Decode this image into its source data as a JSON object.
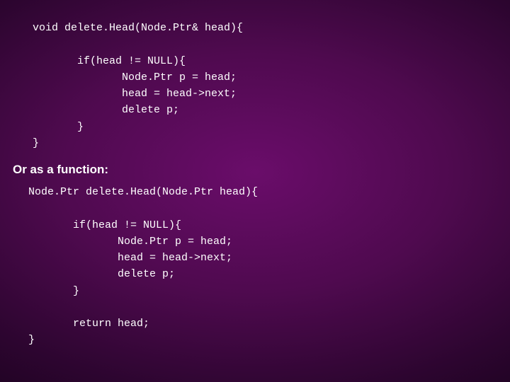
{
  "code1": {
    "l1": "void delete.Head(Node.Ptr& head){",
    "l2": "",
    "l3": "       if(head != NULL){",
    "l4": "              Node.Ptr p = head;",
    "l5": "              head = head->next;",
    "l6": "              delete p;",
    "l7": "       }",
    "l8": "}"
  },
  "caption": "Or as a function:",
  "code2": {
    "l1": "Node.Ptr delete.Head(Node.Ptr head){",
    "l2": "",
    "l3": "       if(head != NULL){",
    "l4": "              Node.Ptr p = head;",
    "l5": "              head = head->next;",
    "l6": "              delete p;",
    "l7": "       }",
    "l8": "",
    "l9": "       return head;",
    "l10": "}"
  }
}
